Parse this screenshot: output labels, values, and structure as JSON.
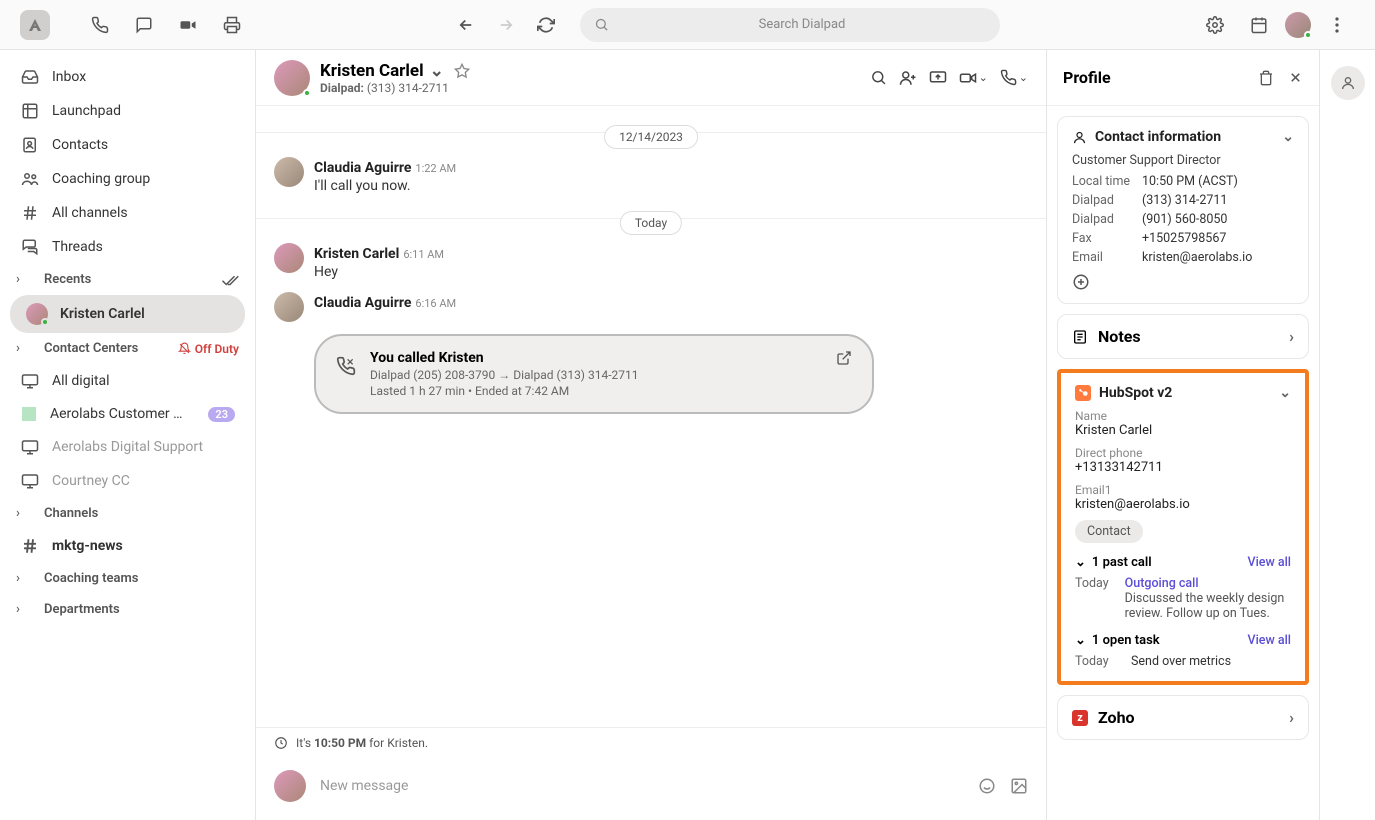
{
  "appbar": {
    "search_placeholder": "Search Dialpad"
  },
  "sidebar": {
    "inbox": "Inbox",
    "launchpad": "Launchpad",
    "contacts": "Contacts",
    "coaching_group": "Coaching group",
    "all_channels": "All channels",
    "threads": "Threads",
    "recents": "Recents",
    "recent_contact": "Kristen Carlel",
    "contact_centers": "Contact Centers",
    "off_duty": "Off Duty",
    "all_digital": "All digital",
    "aerolabs_cs": "Aerolabs Customer Supp...",
    "aerolabs_cs_badge": "23",
    "aerolabs_ds": "Aerolabs Digital Support",
    "courtney_cc": "Courtney CC",
    "channels": "Channels",
    "mktg_news": "mktg-news",
    "coaching_teams": "Coaching teams",
    "departments": "Departments"
  },
  "conversation": {
    "title": "Kristen Carlel",
    "sub_label": "Dialpad:",
    "sub_number": "(313) 314-2711",
    "date_1": "12/14/2023",
    "date_2": "Today",
    "msg1_sender": "Claudia Aguirre",
    "msg1_time": "1:22 AM",
    "msg1_body": "I'll call you now.",
    "msg2_sender": "Kristen Carlel",
    "msg2_time": "6:11 AM",
    "msg2_body": "Hey",
    "msg3_sender": "Claudia Aguirre",
    "msg3_time": "6:16 AM",
    "call_title": "You called Kristen",
    "call_route": "Dialpad (205) 208-3790 → Dialpad (313) 314-2711",
    "call_meta": "Lasted 1 h 27 min • Ended at 7:42 AM",
    "tz_prefix": "It's ",
    "tz_time": "10:50 PM",
    "tz_suffix": " for Kristen.",
    "compose_placeholder": "New message"
  },
  "profile": {
    "title": "Profile",
    "contact_info_title": "Contact information",
    "role": "Customer Support Director",
    "local_time_k": "Local time",
    "local_time_v": "10:50 PM (ACST)",
    "dialpad1_k": "Dialpad",
    "dialpad1_v": "(313) 314-2711",
    "dialpad2_k": "Dialpad",
    "dialpad2_v": "(901) 560-8050",
    "fax_k": "Fax",
    "fax_v": "+15025798567",
    "email_k": "Email",
    "email_v": "kristen@aerolabs.io",
    "notes": "Notes",
    "hubspot_title": "HubSpot v2",
    "hs_name_k": "Name",
    "hs_name_v": "Kristen Carlel",
    "hs_phone_k": "Direct phone",
    "hs_phone_v": "+13133142711",
    "hs_email_k": "Email1",
    "hs_email_v": "kristen@aerolabs.io",
    "hs_contact_chip": "Contact",
    "hs_past_call": "1 past call",
    "view_all": "View all",
    "hs_call_when": "Today",
    "hs_call_what": "Outgoing call",
    "hs_call_desc": "Discussed the weekly design review. Follow up on Tues.",
    "hs_open_task": "1 open task",
    "hs_task_when": "Today",
    "hs_task_what": "Send over metrics",
    "zoho": "Zoho"
  }
}
